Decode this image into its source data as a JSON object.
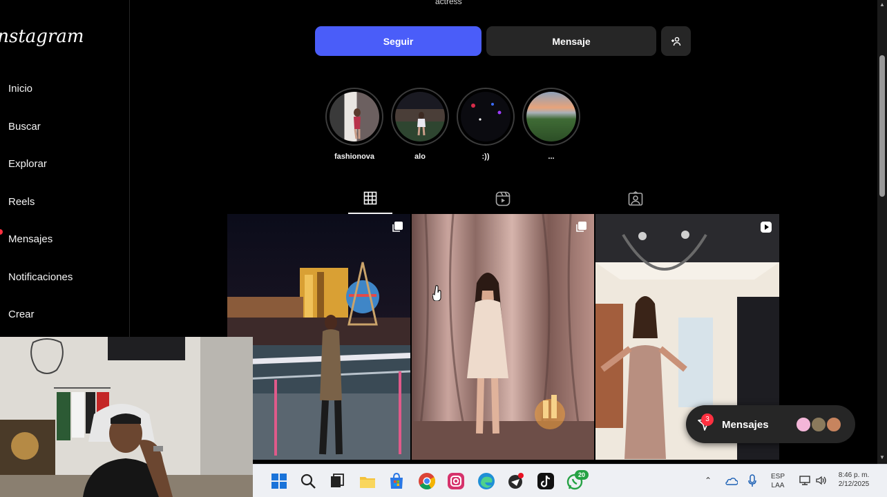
{
  "profile": {
    "subtitle_partial": "actress",
    "follow_label": "Seguir",
    "message_label": "Mensaje"
  },
  "sidebar": {
    "logo": "Instagram",
    "items": [
      {
        "label": "Inicio"
      },
      {
        "label": "Buscar"
      },
      {
        "label": "Explorar"
      },
      {
        "label": "Reels"
      },
      {
        "label": "Mensajes"
      },
      {
        "label": "Notificaciones"
      },
      {
        "label": "Crear"
      }
    ]
  },
  "highlights": [
    {
      "label": "fashionova"
    },
    {
      "label": "alo"
    },
    {
      "label": ":))"
    },
    {
      "label": "..."
    }
  ],
  "tabs": [
    {
      "icon": "grid-icon",
      "active": true
    },
    {
      "icon": "reels-icon",
      "active": false
    },
    {
      "icon": "tagged-icon",
      "active": false
    }
  ],
  "posts": [
    {
      "badge": "carousel-icon"
    },
    {
      "badge": "carousel-icon"
    },
    {
      "badge": "reel-icon"
    }
  ],
  "messages_pill": {
    "label": "Mensajes",
    "unread": "3"
  },
  "taskbar": {
    "whatsapp_badge": "20",
    "language": "ESP",
    "layout": "LAA",
    "time": "8:46 p. m.",
    "date": "2/12/2025"
  },
  "colors": {
    "follow_button": "#4a5df9",
    "secondary_button": "#262626",
    "notification_red": "#ff3040",
    "background": "#000000"
  }
}
